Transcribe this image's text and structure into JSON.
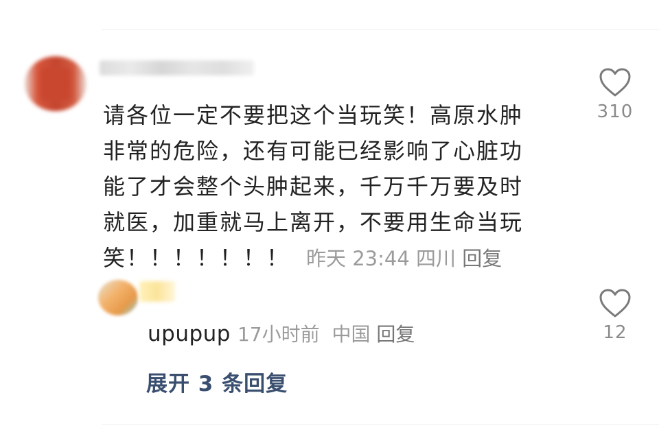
{
  "comment": {
    "lines": [
      "请各位一定不要把这个当玩笑！高原水肿",
      "非常的危险，还有可能已经影响了心脏功",
      "能了才会整个头肿起来，千万千万要及时",
      "就医，加重就马上离开，不要用生命当玩",
      "笑！！！！！！！"
    ],
    "time": "昨天 23:44",
    "location": "四川",
    "reply_label": "回复",
    "likes": "310"
  },
  "reply": {
    "text": "upupup",
    "time": "17小时前",
    "location": "中国",
    "reply_label": "回复",
    "likes": "12"
  },
  "expand": {
    "label": "展开 3 条回复"
  },
  "icons": {
    "like": "heart-outline-icon"
  },
  "colors": {
    "text": "#222222",
    "meta": "#9b9b9b",
    "expand_link": "#3a4f6f",
    "icon": "#7a7a7a"
  }
}
